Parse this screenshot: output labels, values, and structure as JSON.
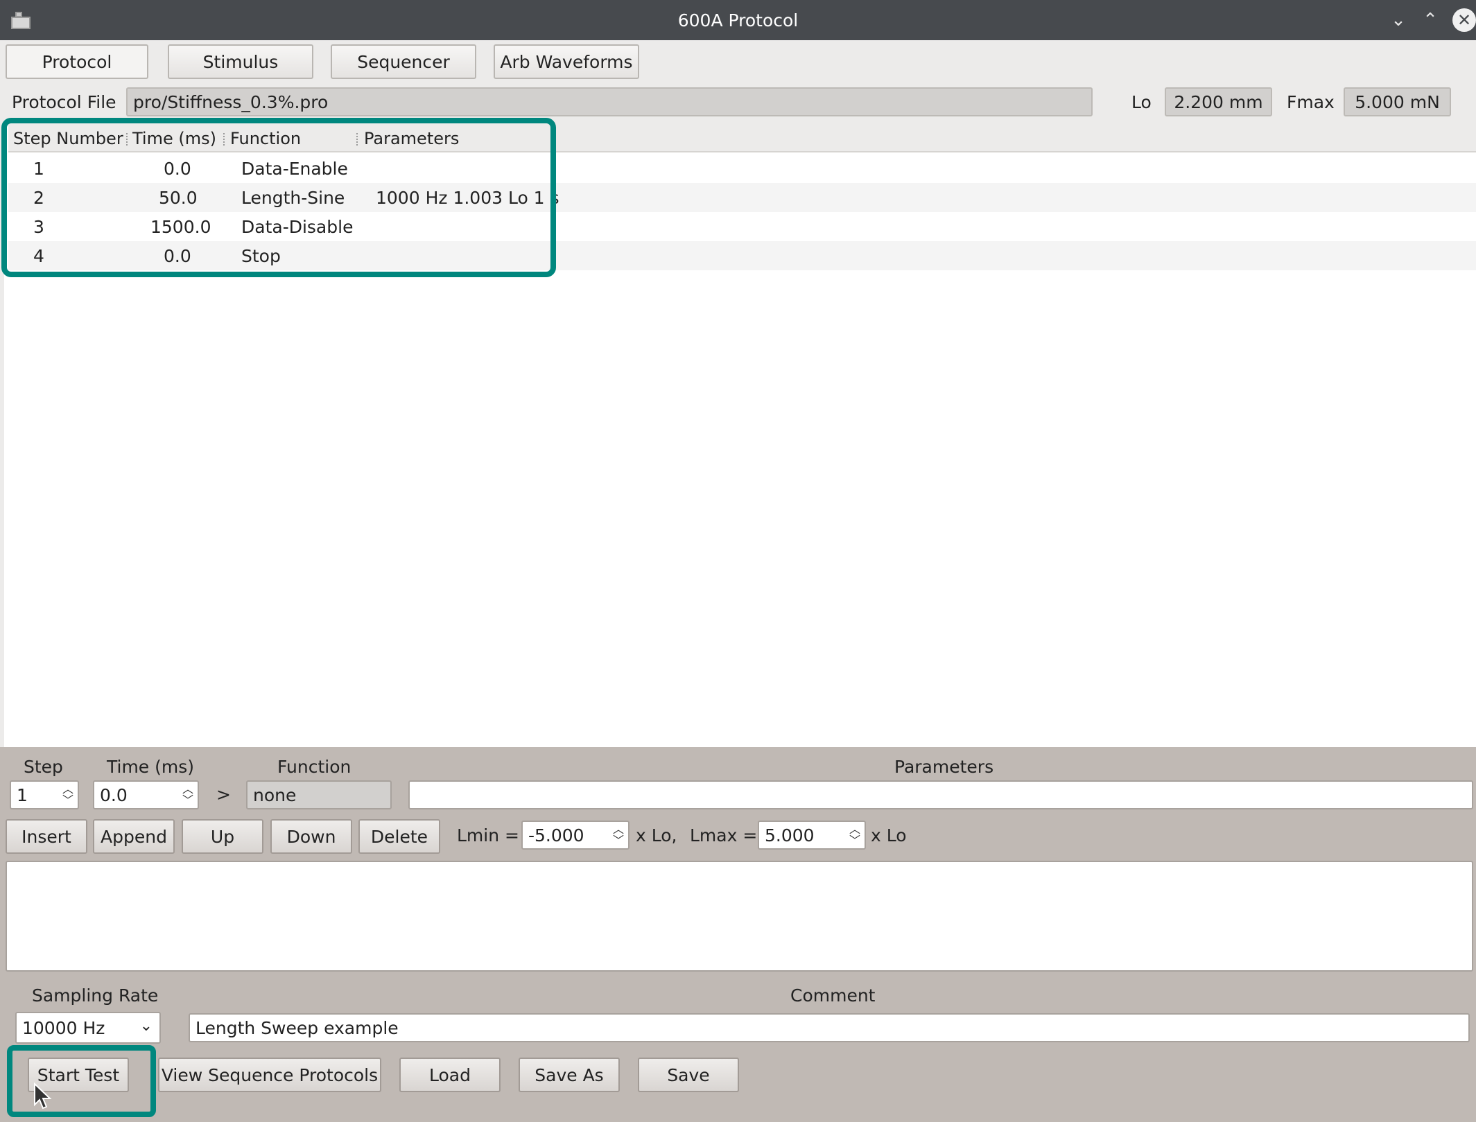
{
  "window": {
    "title": "600A Protocol",
    "minimize": "⌄",
    "maximize": "⌃",
    "close": "✕"
  },
  "tabs": [
    "Protocol",
    "Stimulus",
    "Sequencer",
    "Arb Waveforms"
  ],
  "file": {
    "label": "Protocol File",
    "value": "pro/Stiffness_0.3%.pro",
    "lo_label": "Lo",
    "lo_value": "2.200 mm",
    "fmax_label": "Fmax",
    "fmax_value": "5.000 mN"
  },
  "table": {
    "headers": [
      "Step Number",
      "Time (ms)",
      "Function",
      "Parameters"
    ],
    "rows": [
      {
        "step": "1",
        "time": "0.0",
        "function": "Data-Enable",
        "params": ""
      },
      {
        "step": "2",
        "time": "50.0",
        "function": "Length-Sine",
        "params": "1000 Hz  1.003 Lo  1 s"
      },
      {
        "step": "3",
        "time": "1500.0",
        "function": "Data-Disable",
        "params": ""
      },
      {
        "step": "4",
        "time": "0.0",
        "function": "Stop",
        "params": ""
      }
    ]
  },
  "editor": {
    "step_label": "Step",
    "time_label": "Time (ms)",
    "function_label": "Function",
    "parameters_label": "Parameters",
    "step_value": "1",
    "time_value": "0.0",
    "arrow": ">",
    "function_value": "none",
    "parameters_value": "",
    "buttons": [
      "Insert",
      "Append",
      "Up",
      "Down",
      "Delete"
    ],
    "lmin_label": "Lmin =",
    "lmin_value": "-5.000",
    "lmin_unit": "x Lo,",
    "lmax_label": "Lmax =",
    "lmax_value": "5.000",
    "lmax_unit": "x Lo"
  },
  "footer": {
    "sampling_label": "Sampling Rate",
    "sampling_value": "10000 Hz",
    "comment_label": "Comment",
    "comment_value": "Length Sweep example",
    "buttons": [
      "Start Test",
      "View Sequence Protocols",
      "Load",
      "Save As",
      "Save"
    ]
  },
  "colors": {
    "highlight": "#00877e",
    "titlebar": "#474a4e",
    "panel": "#c0b9b4"
  }
}
